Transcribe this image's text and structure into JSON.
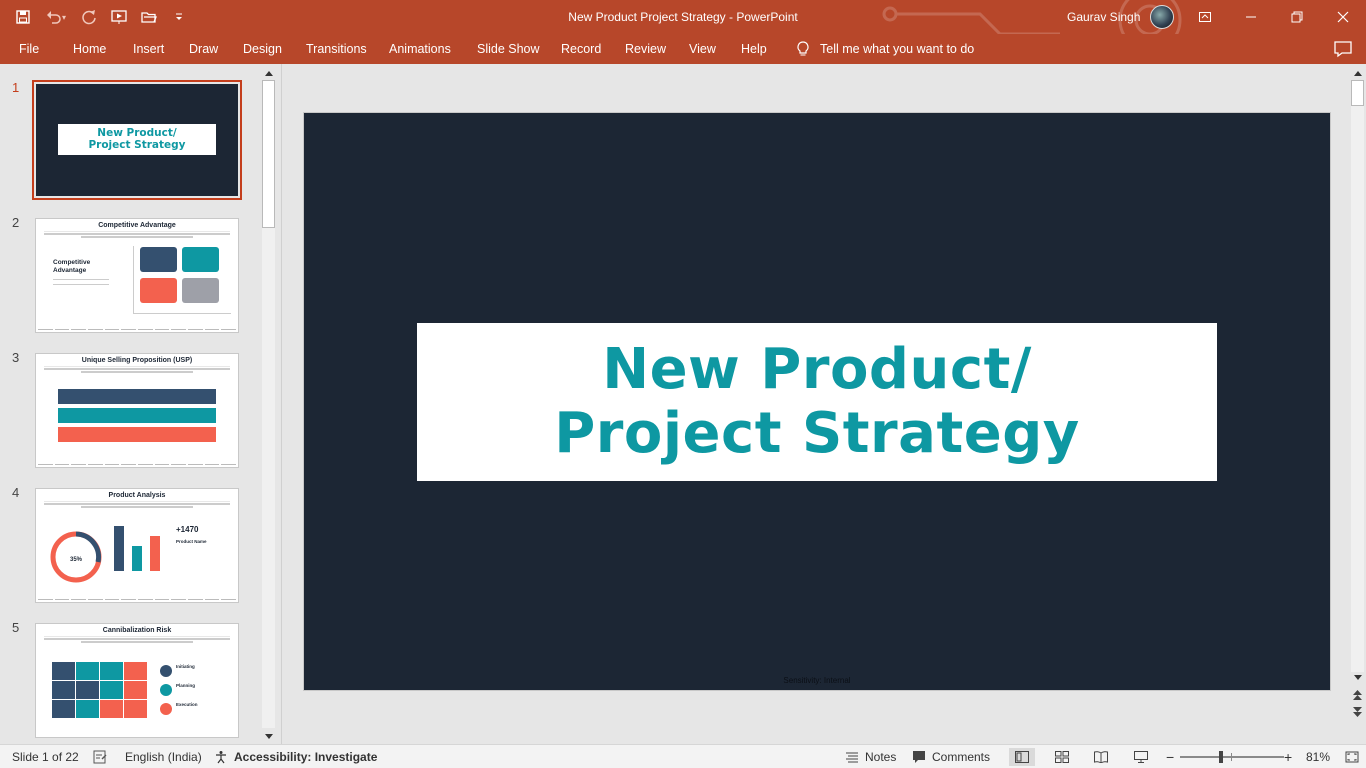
{
  "window": {
    "title": "New Product Project Strategy  -  PowerPoint",
    "user_name": "Gaurav Singh"
  },
  "ribbon": {
    "tabs": [
      "File",
      "Home",
      "Insert",
      "Draw",
      "Design",
      "Transitions",
      "Animations",
      "Slide Show",
      "Record",
      "Review",
      "View",
      "Help"
    ],
    "tell_me": "Tell me what you want to do"
  },
  "thumbnails": [
    {
      "number": "1",
      "title_line1": "New Product/",
      "title_line2": "Project Strategy"
    },
    {
      "number": "2",
      "title": "Competitive Advantage",
      "side_title": "Competitive Advantage"
    },
    {
      "number": "3",
      "title": "Unique Selling Proposition (USP)"
    },
    {
      "number": "4",
      "title": "Product Analysis",
      "donut_label": "35%",
      "big_value": "+1470",
      "sub_label": "Product Name"
    },
    {
      "number": "5",
      "title": "Cannibalization Risk",
      "items": [
        "Initiating",
        "Planning",
        "Execution"
      ]
    }
  ],
  "slide": {
    "title_line1": "New Product/",
    "title_line2": "Project Strategy",
    "sensitivity": "Sensitivity: Internal",
    "background": "#1c2634",
    "accent": "#0e98a2"
  },
  "status": {
    "slide_indicator": "Slide 1 of 22",
    "language": "English (India)",
    "accessibility": "Accessibility: Investigate",
    "notes": "Notes",
    "comments": "Comments",
    "zoom": "81%"
  },
  "colors": {
    "ribbon": "#b7472a",
    "selected_thumb": "#c43e1c"
  }
}
